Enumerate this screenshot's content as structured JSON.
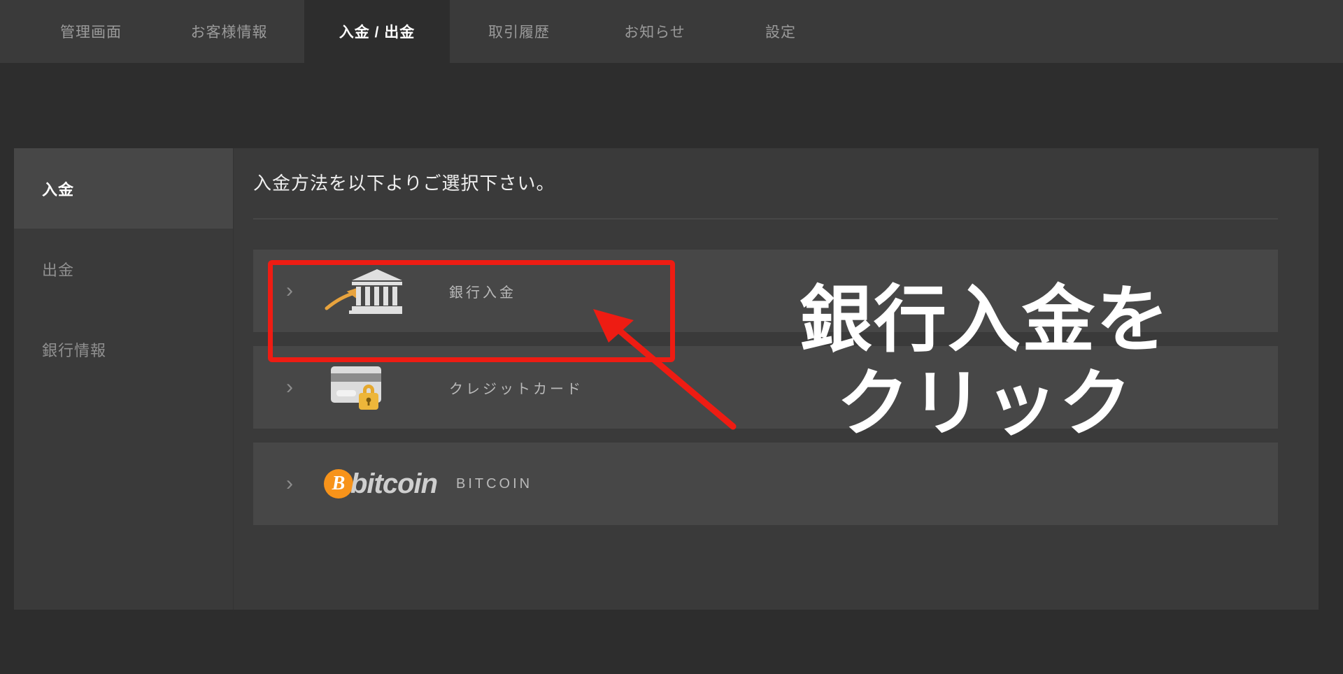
{
  "theme": {
    "page_bg": "#2d2d2d",
    "panel_bg": "#3a3a3a",
    "row_bg": "#474747",
    "accent_red": "#ee1c13",
    "bitcoin_orange": "#f7931a",
    "muted_text": "#8f8f8f"
  },
  "tabs": [
    {
      "label": "管理画面",
      "active": false
    },
    {
      "label": "お客様情報",
      "active": false
    },
    {
      "label": "入金 / 出金",
      "active": true
    },
    {
      "label": "取引履歴",
      "active": false
    },
    {
      "label": "お知らせ",
      "active": false
    },
    {
      "label": "設定",
      "active": false
    }
  ],
  "sidebar": {
    "items": [
      {
        "label": "入金",
        "active": true
      },
      {
        "label": "出金",
        "active": false
      },
      {
        "label": "銀行情報",
        "active": false
      }
    ]
  },
  "content": {
    "heading": "入金方法を以下よりご選択下さい。",
    "methods": [
      {
        "label": "銀行入金",
        "icon": "bank-building-icon",
        "chevron": "›",
        "highlighted": true
      },
      {
        "label": "クレジットカード",
        "icon": "credit-card-lock-icon",
        "chevron": "›",
        "highlighted": false
      },
      {
        "label": "BITCOIN",
        "icon": "bitcoin-logo-icon",
        "chevron": "›",
        "highlighted": false,
        "logo_word": "bitcoin",
        "logo_symbol": "B"
      }
    ]
  },
  "annotation": {
    "line1": "銀行入金を",
    "line2": "クリック",
    "arrow": "red-arrow-pointing-up-left",
    "highlight_box": "red-rectangle-around-bank-deposit-row"
  }
}
